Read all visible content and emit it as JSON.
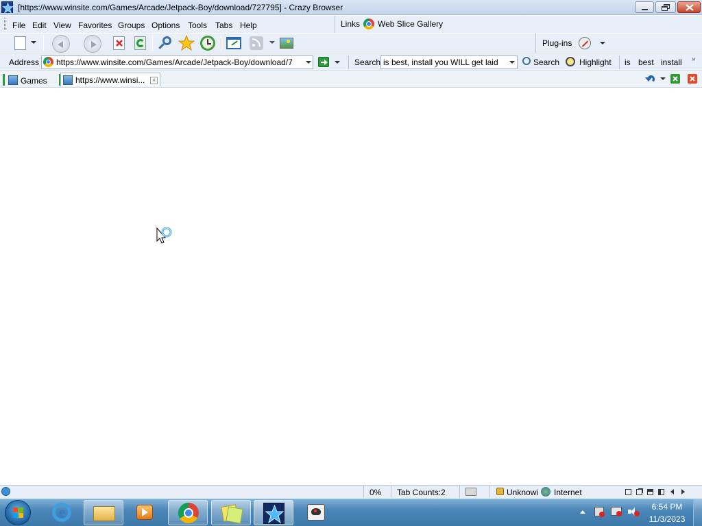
{
  "window": {
    "title": "[https://www.winsite.com/Games/Arcade/Jetpack-Boy/download/727795] - Crazy Browser"
  },
  "menu": [
    "File",
    "Edit",
    "View",
    "Favorites",
    "Groups",
    "Options",
    "Tools",
    "Tabs",
    "Help"
  ],
  "links": {
    "label": "Links",
    "item": "Web Slice Gallery"
  },
  "plugins": {
    "label": "Plug-ins"
  },
  "address": {
    "label": "Address",
    "url": "https://www.winsite.com/Games/Arcade/Jetpack-Boy/download/7"
  },
  "search": {
    "label": "Search",
    "value": "is best, install you WILL get laid",
    "button": "Search",
    "highlight": "Highlight",
    "terms": [
      "is",
      "best",
      "install"
    ]
  },
  "tabs": [
    {
      "label": "Games"
    },
    {
      "label": "https://www.winsi..."
    }
  ],
  "status": {
    "progress": "0%",
    "tab_counts": "Tab Counts:2",
    "security": "Unknowi",
    "zone": "Internet"
  },
  "clock": {
    "time": "6:54 PM",
    "date": "11/3/2023"
  },
  "colors": {
    "accent": "#3d79ab",
    "close": "#c7432a",
    "chrome": "#e9eff8"
  }
}
